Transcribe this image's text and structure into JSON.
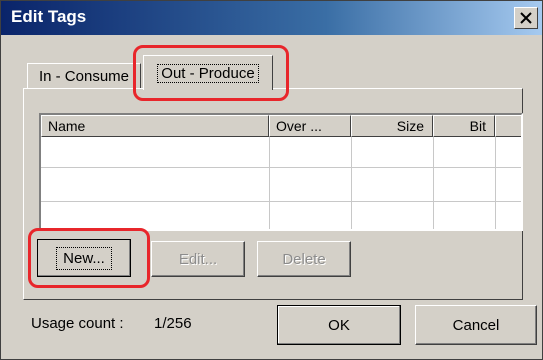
{
  "window": {
    "title": "Edit Tags"
  },
  "tabs": [
    {
      "label": "In - Consume",
      "selected": false
    },
    {
      "label": "Out - Produce",
      "selected": true
    }
  ],
  "list": {
    "columns": [
      "Name",
      "Over ...",
      "Size",
      "Bit"
    ],
    "rows": []
  },
  "buttons": {
    "new_label": "New...",
    "edit_label": "Edit...",
    "delete_label": "Delete",
    "ok_label": "OK",
    "cancel_label": "Cancel"
  },
  "usage": {
    "label": "Usage count :",
    "value": "1/256"
  },
  "colors": {
    "titlebar_start": "#0a246a",
    "titlebar_end": "#a6caf0",
    "dialog_face": "#d4d0c8",
    "highlight": "#e8262b"
  },
  "icons": {
    "close": "close-icon"
  }
}
